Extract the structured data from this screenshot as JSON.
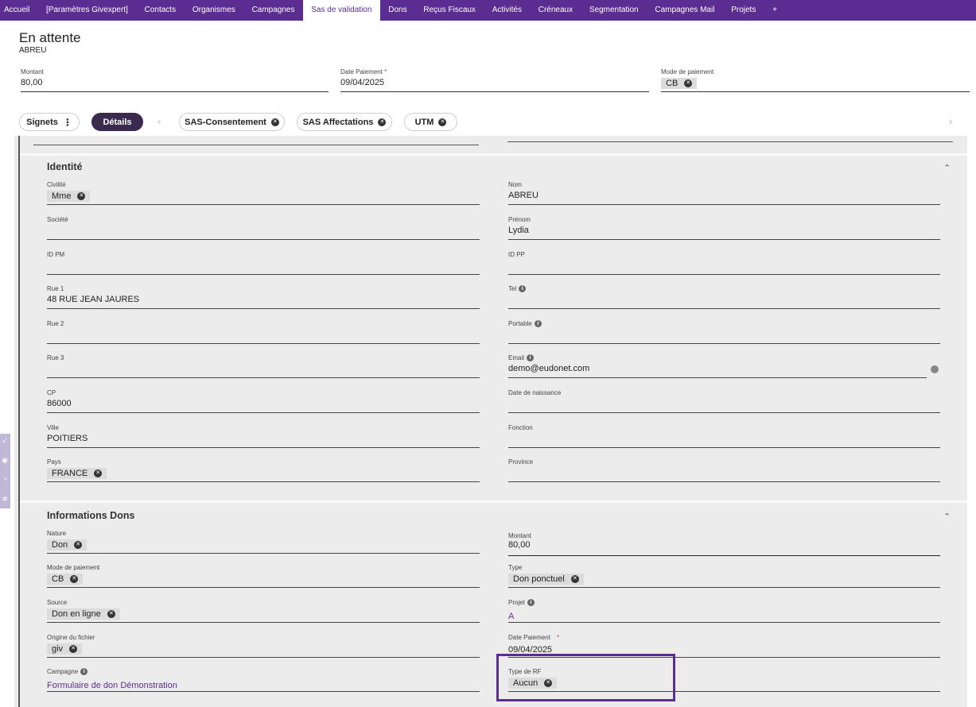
{
  "nav": {
    "items": [
      "Accueil",
      "[Paramètres Givexpert]",
      "Contacts",
      "Organismes",
      "Campagnes",
      "Sas de validation",
      "Dons",
      "Reçus Fiscaux",
      "Activités",
      "Créneaux",
      "Segmentation",
      "Campagnes Mail",
      "Projets",
      "+"
    ],
    "active": "Sas de validation",
    "accent": "#5c2d91"
  },
  "header": {
    "title": "En attente",
    "subtitle": "ABREU",
    "montant": {
      "label": "Montant",
      "value": "80,00"
    },
    "date_paiement": {
      "label": "Date Paiement",
      "required": "*",
      "value": "09/04/2025"
    },
    "mode_paiement": {
      "label": "Mode de paiement",
      "value": "CB"
    }
  },
  "tabs": {
    "signets": "Signets",
    "details": "Détails",
    "consentement": "SAS-Consentement",
    "affectations": "SAS Affectations",
    "utm": "UTM"
  },
  "identite": {
    "title": "Identité",
    "civilite": {
      "label": "Civilité",
      "value": "Mme"
    },
    "nom": {
      "label": "Nom",
      "value": "ABREU"
    },
    "societe": {
      "label": "Société",
      "value": ""
    },
    "prenom": {
      "label": "Prénom",
      "value": "Lydia"
    },
    "id_pm": {
      "label": "ID PM",
      "value": ""
    },
    "id_pp": {
      "label": "ID PP",
      "value": ""
    },
    "rue1": {
      "label": "Rue 1",
      "value": "48 RUE JEAN JAURES"
    },
    "tel": {
      "label": "Tel",
      "value": ""
    },
    "rue2": {
      "label": "Rue 2",
      "value": ""
    },
    "portable": {
      "label": "Portable",
      "value": ""
    },
    "rue3": {
      "label": "Rue 3",
      "value": ""
    },
    "email": {
      "label": "Email",
      "value": "demo@eudonet.com"
    },
    "cp": {
      "label": "CP",
      "value": "86000"
    },
    "date_naissance": {
      "label": "Date de naissance",
      "value": ""
    },
    "ville": {
      "label": "Ville",
      "value": "POITIERS"
    },
    "fonction": {
      "label": "Fonction",
      "value": ""
    },
    "pays": {
      "label": "Pays",
      "value": "FRANCE"
    },
    "province": {
      "label": "Province",
      "value": ""
    }
  },
  "dons": {
    "title": "Informations Dons",
    "nature": {
      "label": "Nature",
      "value": "Don"
    },
    "montant": {
      "label": "Montant",
      "value": "80,00"
    },
    "mode_paiement": {
      "label": "Mode de paiement",
      "value": "CB"
    },
    "type": {
      "label": "Type",
      "value": "Don ponctuel"
    },
    "source": {
      "label": "Source",
      "value": "Don en ligne"
    },
    "projet": {
      "label": "Projet",
      "value": "A"
    },
    "origine": {
      "label": "Origine du fichier",
      "value": "giv"
    },
    "date_paiement": {
      "label": "Date Paiement",
      "required": "*",
      "value": "09/04/2025"
    },
    "campagne": {
      "label": "Campagne",
      "value": "Formulaire de don Démonstration"
    },
    "type_rf": {
      "label": "Type de RF",
      "value": "Aucun"
    }
  }
}
